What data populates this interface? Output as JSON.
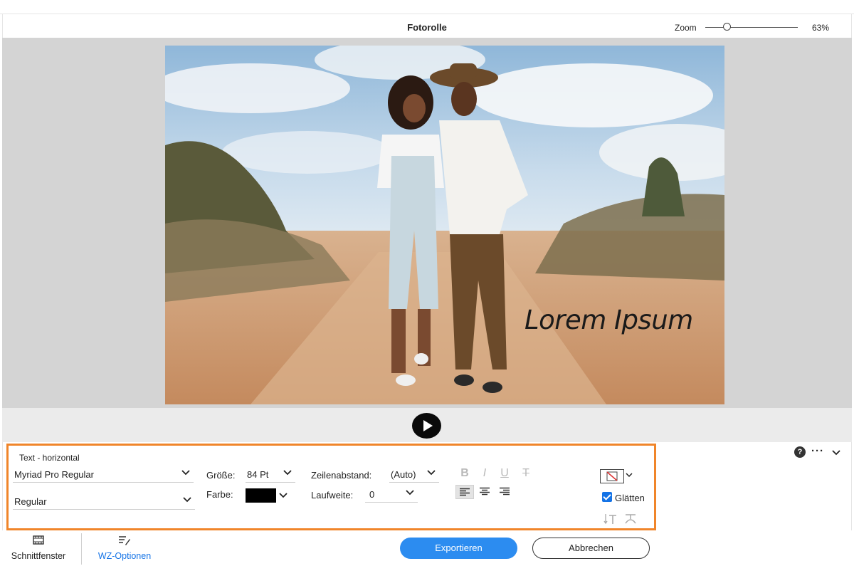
{
  "window": {
    "title": "Fotorolle",
    "zoom_label": "Zoom",
    "zoom_value": "63%",
    "zoom_level_percent": 63
  },
  "preview": {
    "overlay_text": "Lorem Ipsum",
    "photo_description_icon": "photo-preview"
  },
  "playback": {
    "play_icon": "play-icon"
  },
  "text_panel": {
    "title": "Text - horizontal",
    "font_family": "Myriad Pro Regular",
    "font_style": "Regular",
    "size_label": "Größe:",
    "size_value": "84 Pt",
    "color_label": "Farbe:",
    "color_value": "#000000",
    "leading_label": "Zeilenabstand:",
    "leading_value": "(Auto)",
    "tracking_label": "Laufweite:",
    "tracking_value": "0",
    "bold_label": "B",
    "italic_label": "I",
    "underline_label": "U",
    "strike_label": "T",
    "smooth_label": "Glätten",
    "smooth_checked": true,
    "active_alignment": "left"
  },
  "bottom": {
    "tab_timeline": "Schnittfenster",
    "tab_tool_options": "WZ-Optionen",
    "export_button": "Exportieren",
    "cancel_button": "Abbrechen"
  },
  "colors": {
    "accent_blue": "#2c8cf0",
    "highlight_orange": "#f0852a",
    "checkbox_blue": "#1473e6"
  }
}
